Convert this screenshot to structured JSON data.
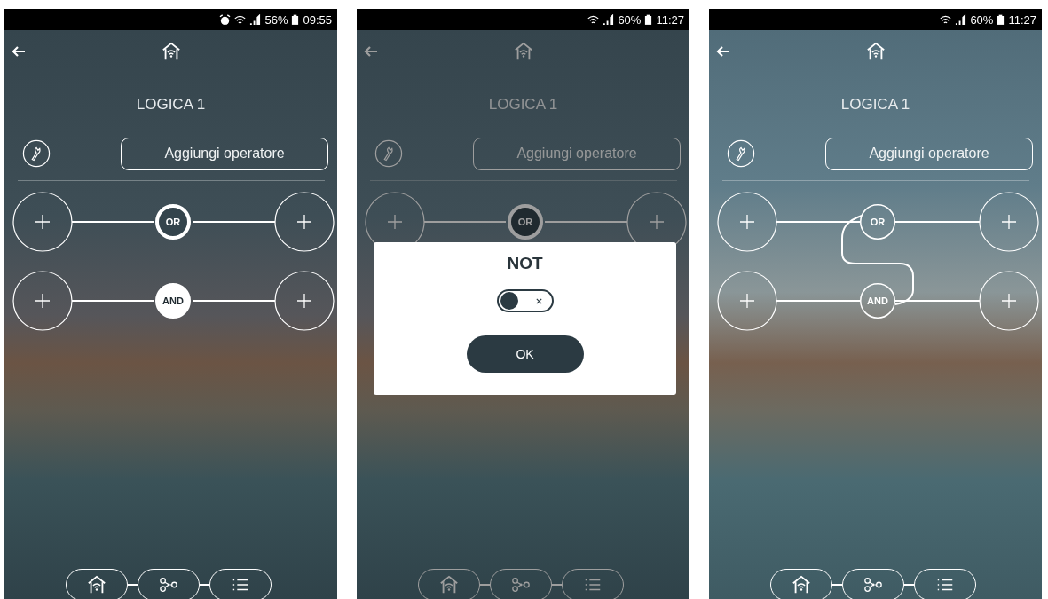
{
  "phones": [
    {
      "kind": "dark",
      "dimmed": false,
      "status_bar": {
        "alarm": true,
        "battery": "56%",
        "time": "09:55"
      },
      "title": "LOGICA 1",
      "add_button": "Aggiungi operatore",
      "linked": false,
      "operators": [
        {
          "label": "OR",
          "kind": "ring"
        },
        {
          "label": "AND",
          "kind": "filled"
        }
      ]
    },
    {
      "kind": "dark",
      "dimmed": true,
      "status_bar": {
        "alarm": false,
        "battery": "60%",
        "time": "11:27"
      },
      "title": "LOGICA 1",
      "add_button": "Aggiungi operatore",
      "linked": false,
      "operators": [
        {
          "label": "OR",
          "kind": "ring"
        }
      ],
      "dialog": {
        "title": "NOT",
        "toggle": {
          "on": false
        },
        "ok_button": "OK"
      }
    },
    {
      "kind": "light",
      "dimmed": false,
      "status_bar": {
        "alarm": false,
        "battery": "60%",
        "time": "11:27"
      },
      "title": "LOGICA 1",
      "add_button": "Aggiungi operatore",
      "linked": true,
      "operators": [
        {
          "label": "OR",
          "kind": "outline"
        },
        {
          "label": "AND",
          "kind": "outline"
        }
      ]
    }
  ]
}
